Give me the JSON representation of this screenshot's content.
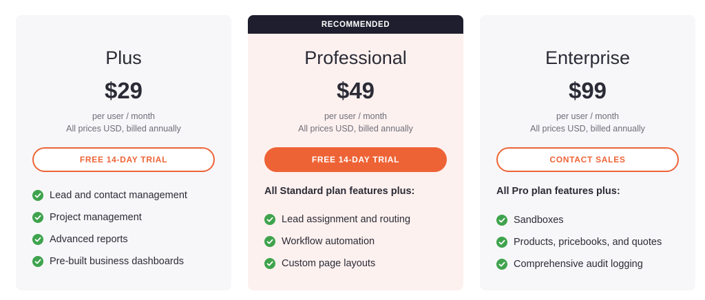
{
  "colors": {
    "accent": "#ee6336",
    "check": "#3fa34d",
    "ribbon": "#1f1e2e",
    "featured_bg": "#fdf1ef",
    "card_bg": "#f7f7f9"
  },
  "plans": [
    {
      "name": "Plus",
      "price": "$29",
      "per": "per user / month",
      "billing": "All prices USD, billed annually",
      "cta": "FREE 14-DAY TRIAL",
      "features": [
        "Lead and contact management",
        "Project management",
        "Advanced reports",
        "Pre-built business dashboards"
      ]
    },
    {
      "ribbon": "RECOMMENDED",
      "name": "Professional",
      "price": "$49",
      "per": "per user / month",
      "billing": "All prices USD, billed annually",
      "cta": "FREE 14-DAY TRIAL",
      "lead": "All Standard plan features plus:",
      "features": [
        "Lead assignment and routing",
        "Workflow automation",
        "Custom page layouts"
      ]
    },
    {
      "name": "Enterprise",
      "price": "$99",
      "per": "per user / month",
      "billing": "All prices USD, billed annually",
      "cta": "CONTACT SALES",
      "lead": "All Pro plan features plus:",
      "features": [
        "Sandboxes",
        "Products, pricebooks, and quotes",
        "Comprehensive audit logging"
      ]
    }
  ],
  "icons": {
    "feature_bullet": "check-circle-icon"
  }
}
